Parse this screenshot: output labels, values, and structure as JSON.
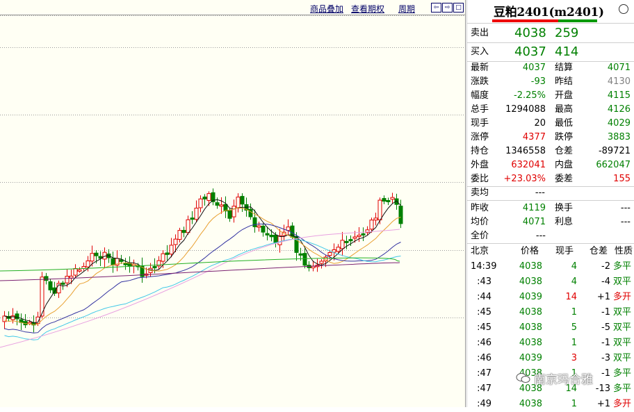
{
  "toolbar": {
    "link_overlay": "商品叠加",
    "link_rights": "查看期权",
    "link_period": "周期",
    "nav_left": "⇦",
    "nav_right": "⇨",
    "nav_max": "□"
  },
  "quote": {
    "title": "豆粕2401(m2401)",
    "sell_label": "卖出",
    "sell_price": "4038",
    "sell_vol": "259",
    "buy_label": "买入",
    "buy_price": "4037",
    "buy_vol": "414",
    "stats": [
      {
        "l1": "最新",
        "v1": "4037",
        "c1": "green",
        "l2": "结算",
        "v2": "4071",
        "c2": "green"
      },
      {
        "l1": "涨跌",
        "v1": "-93",
        "c1": "green",
        "l2": "昨结",
        "v2": "4130",
        "c2": "grey"
      },
      {
        "l1": "幅度",
        "v1": "-2.25%",
        "c1": "green",
        "l2": "开盘",
        "v2": "4115",
        "c2": "green"
      },
      {
        "l1": "总手",
        "v1": "1294088",
        "c1": "black",
        "l2": "最高",
        "v2": "4126",
        "c2": "green"
      },
      {
        "l1": "现手",
        "v1": "20",
        "c1": "black",
        "l2": "最低",
        "v2": "4029",
        "c2": "green"
      },
      {
        "l1": "涨停",
        "v1": "4377",
        "c1": "red",
        "l2": "跌停",
        "v2": "3883",
        "c2": "green"
      },
      {
        "l1": "持仓",
        "v1": "1346558",
        "c1": "black",
        "l2": "仓差",
        "v2": "-89721",
        "c2": "black"
      },
      {
        "l1": "外盘",
        "v1": "632041",
        "c1": "red",
        "l2": "内盘",
        "v2": "662047",
        "c2": "green"
      },
      {
        "l1": "委比",
        "v1": "+23.03%",
        "c1": "red",
        "l2": "委差",
        "v2": "155",
        "c2": "red"
      }
    ],
    "avg_label": "卖均",
    "avg_val": "---",
    "stats2": [
      {
        "l1": "昨收",
        "v1": "4119",
        "c1": "green",
        "l2": "换手",
        "v2": "---",
        "c2": "black"
      },
      {
        "l1": "均价",
        "v1": "4071",
        "c1": "green",
        "l2": "利息",
        "v2": "---",
        "c2": "black"
      },
      {
        "l1": "全价",
        "v1": "---",
        "c1": "black",
        "l2": "",
        "v2": "",
        "c2": "black"
      }
    ],
    "tick_headers": {
      "time": "北京",
      "price": "价格",
      "vol": "现手",
      "oi": "仓差",
      "nature": "性质"
    },
    "ticks": [
      {
        "t": "14:39",
        "p": "4038",
        "vol": "4",
        "vc": "green",
        "oi": "-2",
        "n": "多平",
        "nc": "green"
      },
      {
        "t": ":43",
        "p": "4038",
        "vol": "4",
        "vc": "green",
        "oi": "-4",
        "n": "双平",
        "nc": "green"
      },
      {
        "t": ":44",
        "p": "4039",
        "vol": "14",
        "vc": "red",
        "oi": "+1",
        "n": "多开",
        "nc": "red"
      },
      {
        "t": ":45",
        "p": "4038",
        "vol": "1",
        "vc": "green",
        "oi": "-1",
        "n": "双平",
        "nc": "green"
      },
      {
        "t": ":45",
        "p": "4038",
        "vol": "5",
        "vc": "green",
        "oi": "-5",
        "n": "双平",
        "nc": "green"
      },
      {
        "t": ":46",
        "p": "4038",
        "vol": "1",
        "vc": "green",
        "oi": "-1",
        "n": "双平",
        "nc": "green"
      },
      {
        "t": ":46",
        "p": "4039",
        "vol": "3",
        "vc": "red",
        "oi": "-3",
        "n": "双平",
        "nc": "green"
      },
      {
        "t": ":47",
        "p": "4038",
        "vol": "1",
        "vc": "green",
        "oi": "-1",
        "n": "多平",
        "nc": "green"
      },
      {
        "t": ":47",
        "p": "4038",
        "vol": "14",
        "vc": "green",
        "oi": "-13",
        "n": "多平",
        "nc": "green"
      },
      {
        "t": ":49",
        "p": "4038",
        "vol": "1",
        "vc": "green",
        "oi": "+1",
        "n": "多开",
        "nc": "red"
      }
    ]
  },
  "watermark": "南京玛合雅",
  "colors": {
    "up": "#e00000",
    "down": "#008000",
    "bg": "#fffff4"
  }
}
